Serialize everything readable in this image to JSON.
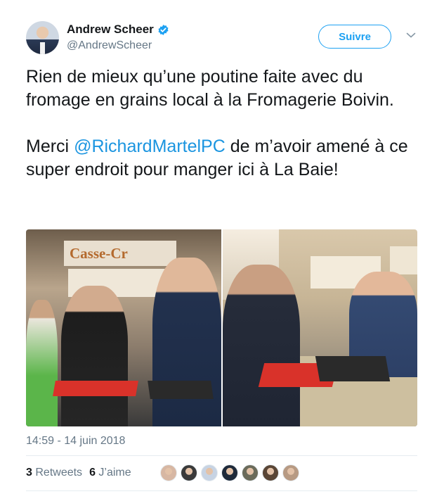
{
  "author": {
    "name": "Andrew Scheer",
    "handle": "@AndrewScheer",
    "verified": true
  },
  "follow_label": "Suivre",
  "tweet": {
    "paragraph1": "Rien de mieux qu’une poutine faite avec du fromage en grains local à la Fromagerie Boivin.",
    "paragraph2_prefix": "Merci ",
    "mention": "@RichardMartelPC",
    "paragraph2_suffix": " de m’avoir amené à ce super endroit pour manger ici à La Baie!"
  },
  "media": {
    "sign_text": "Casse-Cr"
  },
  "timestamp": "14:59 - 14 juin 2018",
  "stats": {
    "retweets_count": "3",
    "retweets_label": "Retweets",
    "likes_count": "6",
    "likes_label": "J’aime"
  },
  "colors": {
    "accent": "#1da1f2",
    "mention": "#1b95e0",
    "secondary_text": "#657786"
  },
  "liker_avatars": [
    {
      "color": "#d7b7a3"
    },
    {
      "color": "#3a3a3a"
    },
    {
      "color": "#c7d3e3"
    },
    {
      "color": "#1f2a3a"
    },
    {
      "color": "#6b6b5a"
    },
    {
      "color": "#5a4636"
    },
    {
      "color": "#b79a83"
    }
  ]
}
